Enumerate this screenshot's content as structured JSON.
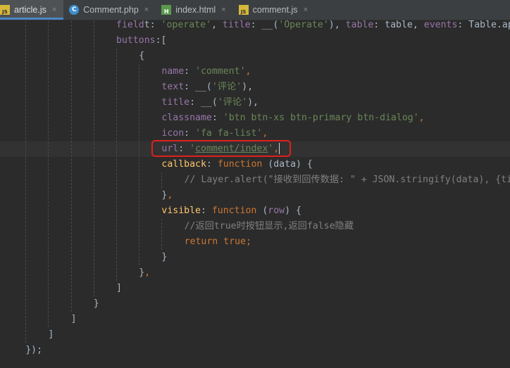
{
  "tabs": [
    {
      "label": "article.js",
      "icon": "js-file-icon",
      "active": true
    },
    {
      "label": "Comment.php",
      "icon": "php-file-icon",
      "active": false
    },
    {
      "label": "index.html",
      "icon": "html-file-icon",
      "active": false
    },
    {
      "label": "comment.js",
      "icon": "js-file-icon",
      "active": false
    }
  ],
  "tab_close_glyph": "×",
  "editor": {
    "lines": [
      {
        "indent": 20,
        "current": false,
        "tokens": [
          [
            "p",
            "field"
          ],
          [
            "",
            "t: "
          ],
          [
            "s",
            "'operate'"
          ],
          [
            "",
            ", "
          ],
          [
            "p",
            "title"
          ],
          [
            "",
            ": __("
          ],
          [
            "s",
            "'Operate'"
          ],
          [
            "",
            "), "
          ],
          [
            "p",
            "table"
          ],
          [
            "",
            ": table, "
          ],
          [
            "p",
            "events"
          ],
          [
            "",
            ": Table.api."
          ]
        ]
      },
      {
        "indent": 20,
        "current": false,
        "tokens": [
          [
            "p",
            "buttons"
          ],
          [
            "",
            ":["
          ]
        ]
      },
      {
        "indent": 24,
        "current": false,
        "tokens": [
          [
            "",
            "{"
          ]
        ]
      },
      {
        "indent": 28,
        "current": false,
        "tokens": [
          [
            "p",
            "name"
          ],
          [
            "",
            ": "
          ],
          [
            "s",
            "'comment'"
          ],
          [
            "k",
            ","
          ]
        ]
      },
      {
        "indent": 28,
        "current": false,
        "tokens": [
          [
            "p",
            "text"
          ],
          [
            "",
            ": __("
          ],
          [
            "s",
            "'评论'"
          ],
          [
            "",
            "),"
          ]
        ]
      },
      {
        "indent": 28,
        "current": false,
        "tokens": [
          [
            "p",
            "title"
          ],
          [
            "",
            ": __("
          ],
          [
            "s",
            "'评论'"
          ],
          [
            "",
            "),"
          ]
        ]
      },
      {
        "indent": 28,
        "current": false,
        "tokens": [
          [
            "p",
            "classname"
          ],
          [
            "",
            ": "
          ],
          [
            "s",
            "'btn btn-xs btn-primary btn-dialog'"
          ],
          [
            "k",
            ","
          ]
        ]
      },
      {
        "indent": 28,
        "current": false,
        "tokens": [
          [
            "p",
            "icon"
          ],
          [
            "",
            ": "
          ],
          [
            "s",
            "'fa fa-list'"
          ],
          [
            "k",
            ","
          ]
        ]
      },
      {
        "indent": 28,
        "current": true,
        "tokens": [
          [
            "p",
            "url"
          ],
          [
            "",
            ": "
          ],
          [
            "s",
            "'"
          ],
          [
            "u",
            "comment/index"
          ],
          [
            "s",
            "'"
          ],
          [
            "k",
            ","
          ]
        ]
      },
      {
        "indent": 28,
        "current": false,
        "tokens": [
          [
            "f",
            "callback"
          ],
          [
            "",
            ": "
          ],
          [
            "k",
            "function"
          ],
          [
            "",
            " (data) {"
          ]
        ]
      },
      {
        "indent": 32,
        "current": false,
        "tokens": [
          [
            "c",
            "// Layer.alert(\"接收到回传数据: \" + JSON.stringify(data), {tit"
          ]
        ]
      },
      {
        "indent": 28,
        "current": false,
        "tokens": [
          [
            "",
            "}"
          ],
          [
            "k",
            ","
          ]
        ]
      },
      {
        "indent": 28,
        "current": false,
        "tokens": [
          [
            "f",
            "visible"
          ],
          [
            "",
            ": "
          ],
          [
            "k",
            "function"
          ],
          [
            "",
            " ("
          ],
          [
            "p",
            "row"
          ],
          [
            "",
            ") {"
          ]
        ]
      },
      {
        "indent": 32,
        "current": false,
        "tokens": [
          [
            "c",
            "//返回true时按钮显示,返回false隐藏"
          ]
        ]
      },
      {
        "indent": 32,
        "current": false,
        "tokens": [
          [
            "k",
            "return"
          ],
          [
            "k",
            " true"
          ],
          [
            "k",
            ";"
          ]
        ]
      },
      {
        "indent": 28,
        "current": false,
        "tokens": [
          [
            "",
            "}"
          ]
        ]
      },
      {
        "indent": 24,
        "current": false,
        "tokens": [
          [
            "",
            "}"
          ],
          [
            "k",
            ","
          ]
        ]
      },
      {
        "indent": 20,
        "current": false,
        "tokens": [
          [
            "",
            "]"
          ]
        ]
      },
      {
        "indent": 16,
        "current": false,
        "tokens": [
          [
            "",
            "}"
          ]
        ]
      },
      {
        "indent": 12,
        "current": false,
        "tokens": [
          [
            "",
            "]"
          ]
        ]
      },
      {
        "indent": 8,
        "current": false,
        "tokens": [
          [
            "",
            "]"
          ]
        ]
      },
      {
        "indent": 4,
        "current": false,
        "tokens": [
          [
            "",
            "});"
          ]
        ]
      }
    ]
  },
  "colors": {
    "background": "#2b2b2b",
    "keyword": "#cc7832",
    "property": "#9876aa",
    "string": "#6a8759",
    "function_name": "#ffc66d",
    "comment": "#808080",
    "highlight_box": "#e0201b"
  }
}
